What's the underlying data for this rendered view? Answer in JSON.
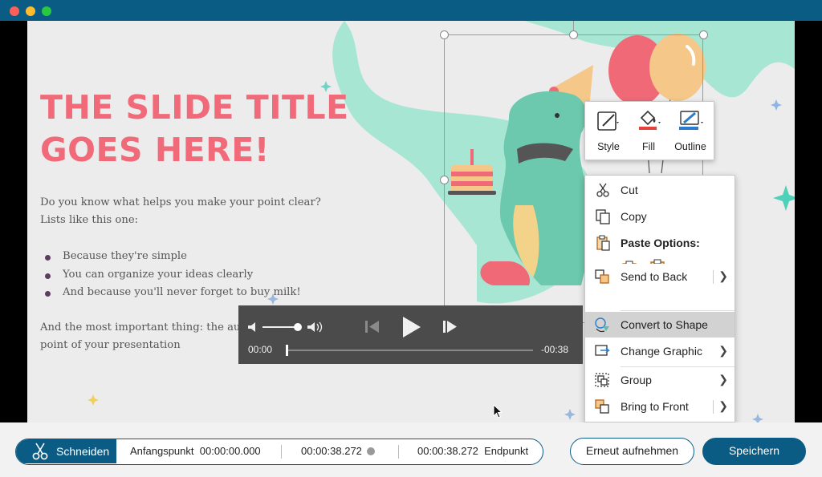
{
  "window": {
    "colors": {
      "titlebar": "#0b5c84",
      "accent": "#0b5c84",
      "slide_title": "#f06a7a"
    }
  },
  "slide": {
    "title_line1": "THE SLIDE TITLE",
    "title_line2": "GOES HERE!",
    "intro_line1": "Do you know what helps you make your point clear?",
    "intro_line2": "Lists like this one:",
    "bullets": [
      "Because they're simple",
      "You can organize your ideas clearly",
      "And because you'll never forget to buy milk!"
    ],
    "outro_line1": "And the most important thing: the aud",
    "outro_line2": "point of your presentation"
  },
  "minibar": {
    "style_label": "Style",
    "fill_label": "Fill",
    "outline_label": "Outline"
  },
  "context_menu": {
    "cut": "Cut",
    "copy": "Copy",
    "paste_options": "Paste Options:",
    "convert_to_shape": "Convert to Shape",
    "change_graphic": "Change Graphic",
    "group": "Group",
    "bring_to_front": "Bring to Front",
    "send_to_back": "Send to Back"
  },
  "media": {
    "current_time": "00:00",
    "remaining_time": "-00:38",
    "volume_level": 0.75,
    "progress": 0.0
  },
  "bottombar": {
    "cut_label": "Schneiden",
    "start_label": "Anfangspunkt",
    "start_value": "00:00:00.000",
    "duration_value": "00:00:38.272",
    "end_value": "00:00:38.272",
    "end_label": "Endpunkt",
    "retake_label": "Erneut aufnehmen",
    "save_label": "Speichern"
  }
}
